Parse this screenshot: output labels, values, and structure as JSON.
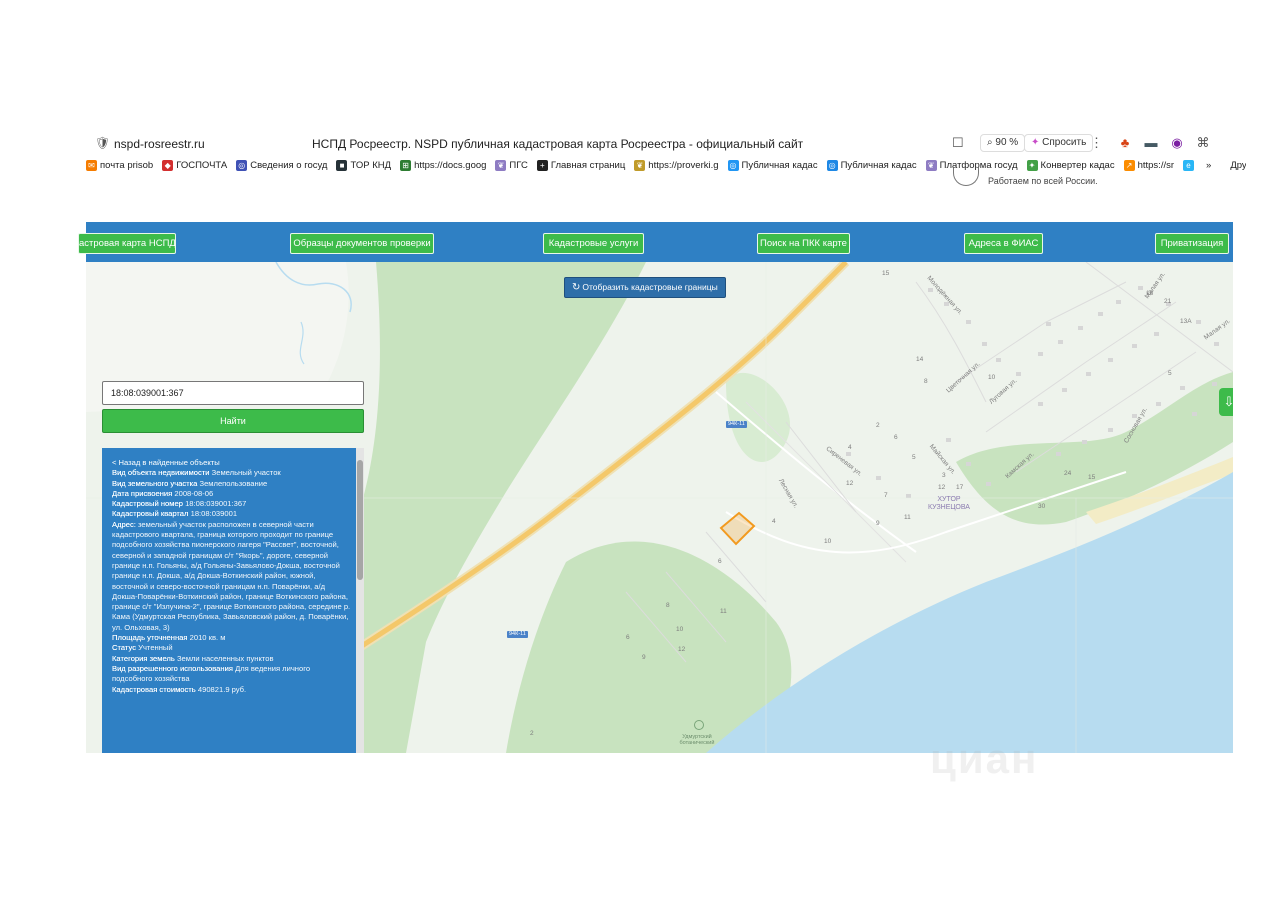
{
  "browser": {
    "url": "nspd-rosreestr.ru",
    "title": "НСПД Росреестр. NSPD публичная кадастровая карта Росреестра - официальный сайт",
    "zoom": "90 %",
    "ask_label": "Спросить",
    "icons": {
      "shield": "shield-icon",
      "bookmark": "bookmark-icon",
      "more": "more-vertical-icon"
    }
  },
  "bookmarks": {
    "items": [
      {
        "label": "почта prisob",
        "color": "#f57c00"
      },
      {
        "label": "ГОСПОЧТА",
        "color": "#d32f2f"
      },
      {
        "label": "Сведения о госуд",
        "color": "#3f51b5"
      },
      {
        "label": "ТОР КНД",
        "color": "#263238"
      },
      {
        "label": "https://docs.goog",
        "color": "#2e7d32"
      },
      {
        "label": "ПГС",
        "color": "#8e7cc3"
      },
      {
        "label": "Главная страниц",
        "color": "#212121"
      },
      {
        "label": "https://proverki.g",
        "color": "#c09b2a"
      },
      {
        "label": "Публичная кадас",
        "color": "#2196f3"
      },
      {
        "label": "Публичная кадас",
        "color": "#1e88e5"
      },
      {
        "label": "Платформа госуд",
        "color": "#8e7cc3"
      },
      {
        "label": "Конвертер кадас",
        "color": "#43a047"
      },
      {
        "label": "https://sr",
        "color": "#fb8c00"
      }
    ],
    "overflow_label": "»",
    "other_label": "Другие за"
  },
  "page_note": "Работаем по всей России.",
  "nav": {
    "items": [
      {
        "label": "астровая карта НСПД"
      },
      {
        "label": "Образцы документов проверки"
      },
      {
        "label": "Кадастровые услуги"
      },
      {
        "label": "Поиск на ПКК карте"
      },
      {
        "label": "Адреса в ФИАС"
      },
      {
        "label": "Приватизация"
      }
    ]
  },
  "map": {
    "cad_button": "Отобразить кадастровые границы",
    "search_value": "18:08:039001:367",
    "find_label": "Найти",
    "road_badges": [
      "94К-11",
      "94К-11"
    ],
    "hutor_label": "ХУТОР КУЗНЕЦОВА",
    "botanic_label": "Удмуртский ботанический",
    "watermark": "циан",
    "street_labels": [
      "Молодёжная ул.",
      "Цветочная ул.",
      "Луговая ул.",
      "Сиреневая ул.",
      "Лесная ул.",
      "Майская ул.",
      "Камская ул.",
      "Сосновая ул.",
      "Малая ул.",
      "Малая ул."
    ],
    "house_numbers": [
      "15",
      "16",
      "21",
      "13А",
      "14",
      "10",
      "8",
      "4",
      "2",
      "6",
      "5",
      "3",
      "12",
      "17",
      "24",
      "15",
      "30",
      "12",
      "7",
      "9",
      "11",
      "10",
      "4",
      "6",
      "8",
      "11",
      "6",
      "10",
      "12",
      "9",
      "5",
      "2"
    ]
  },
  "info": {
    "back": "< Назад в найденные объекты",
    "fields": [
      {
        "k": "Вид объекта недвижимости",
        "v": "Земельный участок"
      },
      {
        "k": "Вид земельного участка",
        "v": "Землепользование"
      },
      {
        "k": "Дата присвоения",
        "v": "2008-08-06"
      },
      {
        "k": "Кадастровый номер",
        "v": "18:08:039001:367"
      },
      {
        "k": "Кадастровый квартал",
        "v": "18:08:039001"
      },
      {
        "k": "Адрес:",
        "v": "земельный участок расположен в северной части кадастрового квартала, граница которого проходит по границе подсобного хозяйства пионерского лагеря \"Рассвет\", восточной, северной и западной границам с/т \"Якорь\", дороге, северной границе н.п. Гольяны, а/д Гольяны-Завьялово-Докша, восточной границе н.п. Докша, а/д Докша-Воткинский район, южной, восточной и северо-восточной границам н.п. Поварёнки, а/д Докша-Поварёнки-Воткинский район, границе Воткинского района, границе с/т \"Излучина-2\", границе Воткинского района, середине р. Кама (Удмуртская Республика, Завьяловский район, д. Поварёнки, ул. Ольховая, 3)"
      },
      {
        "k": "Площадь уточненная",
        "v": "2010 кв. м"
      },
      {
        "k": "Статус",
        "v": "Учтенный"
      },
      {
        "k": "Категория земель",
        "v": "Земли населенных пунктов"
      },
      {
        "k": "Вид разрешенного использования",
        "v": "Для ведения личного подсобного хозяйства"
      },
      {
        "k": "Кадастровая стоимость",
        "v": "490821.9 руб."
      }
    ]
  },
  "colors": {
    "nav_bg": "#2f80c4",
    "button_green": "#3dbb4a",
    "water": "#b7dcf0",
    "forest": "#c8e3bf",
    "road": "#f4c86a",
    "parcel": "#f29a1f"
  }
}
